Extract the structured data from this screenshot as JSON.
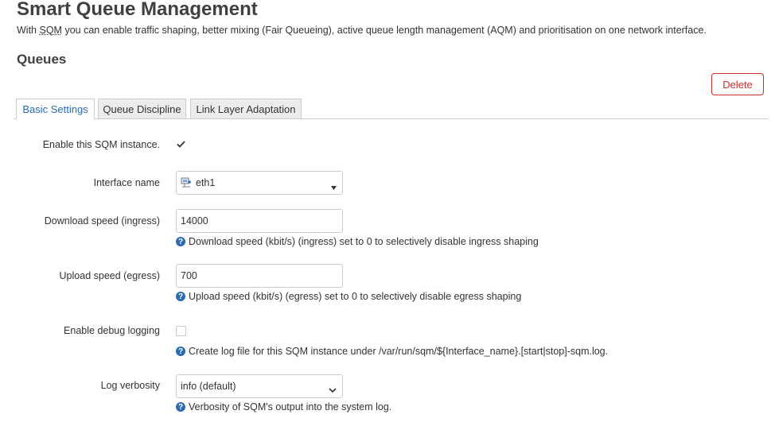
{
  "page": {
    "title": "Smart Queue Management",
    "desc_prefix": "With ",
    "desc_abbr": "SQM",
    "desc_suffix": " you can enable traffic shaping, better mixing (Fair Queueing), active queue length management (AQM) and prioritisation on one network interface."
  },
  "section": {
    "title": "Queues",
    "delete_label": "Delete"
  },
  "tabs": [
    {
      "label": "Basic Settings",
      "active": true
    },
    {
      "label": "Queue Discipline",
      "active": false
    },
    {
      "label": "Link Layer Adaptation",
      "active": false
    }
  ],
  "form": {
    "enable": {
      "label": "Enable this SQM instance.",
      "checked": true
    },
    "interface": {
      "label": "Interface name",
      "value": "eth1",
      "icon": "network-interface-icon"
    },
    "download": {
      "label": "Download speed (ingress)",
      "value": "14000",
      "help": "Download speed (kbit/s) (ingress) set to 0 to selectively disable ingress shaping"
    },
    "upload": {
      "label": "Upload speed (egress)",
      "value": "700",
      "help": "Upload speed (kbit/s) (egress) set to 0 to selectively disable egress shaping"
    },
    "debug": {
      "label": "Enable debug logging",
      "checked": false,
      "help": "Create log file for this SQM instance under /var/run/sqm/${Interface_name}.[start|stop]-sqm.log."
    },
    "verbosity": {
      "label": "Log verbosity",
      "value": "info (default)",
      "help": "Verbosity of SQM's output into the system log."
    }
  },
  "colors": {
    "accent": "#2a6bb5",
    "danger": "#c9302c"
  }
}
